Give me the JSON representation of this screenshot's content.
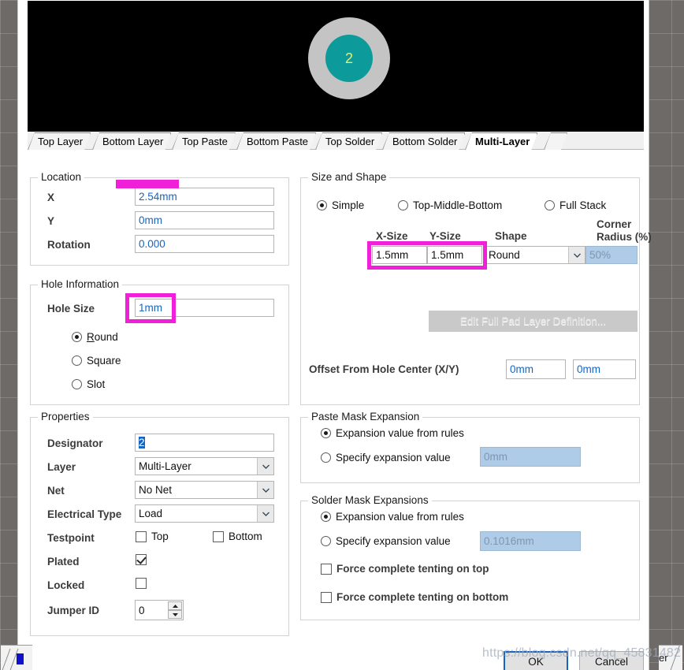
{
  "preview": {
    "pad_designator": "2",
    "colors": {
      "background": "#000000",
      "pad_outer": "#c3c4c3",
      "pad_inner": "#0c9a9a",
      "label": "#e8ef6b"
    }
  },
  "layer_tabs": [
    {
      "label": "Top Layer",
      "active": false
    },
    {
      "label": "Bottom Layer",
      "active": false
    },
    {
      "label": "Top Paste",
      "active": false
    },
    {
      "label": "Bottom Paste",
      "active": false
    },
    {
      "label": "Top Solder",
      "active": false
    },
    {
      "label": "Bottom Solder",
      "active": false
    },
    {
      "label": "Multi-Layer",
      "active": true
    }
  ],
  "location": {
    "legend": "Location",
    "x_label": "X",
    "x_value": "2.54mm",
    "y_label": "Y",
    "y_value": "0mm",
    "rotation_label": "Rotation",
    "rotation_value": "0.000"
  },
  "hole_information": {
    "legend": "Hole Information",
    "hole_size_label": "Hole Size",
    "hole_size_value": "1mm",
    "shapes": [
      {
        "label": "Round",
        "selected": true
      },
      {
        "label": "Square",
        "selected": false
      },
      {
        "label": "Slot",
        "selected": false
      }
    ]
  },
  "properties": {
    "legend": "Properties",
    "designator_label": "Designator",
    "designator_value": "2",
    "layer_label": "Layer",
    "layer_value": "Multi-Layer",
    "net_label": "Net",
    "net_value": "No Net",
    "electrical_type_label": "Electrical Type",
    "electrical_type_value": "Load",
    "testpoint_label": "Testpoint",
    "testpoint_top_label": "Top",
    "testpoint_top_checked": false,
    "testpoint_bottom_label": "Bottom",
    "testpoint_bottom_checked": false,
    "plated_label": "Plated",
    "plated_checked": true,
    "locked_label": "Locked",
    "locked_checked": false,
    "jumper_id_label": "Jumper ID",
    "jumper_id_value": "0"
  },
  "size_and_shape": {
    "legend": "Size and Shape",
    "modes": [
      {
        "label": "Simple",
        "selected": true
      },
      {
        "label": "Top-Middle-Bottom",
        "selected": false
      },
      {
        "label": "Full Stack",
        "selected": false
      }
    ],
    "x_size_header": "X-Size",
    "y_size_header": "Y-Size",
    "shape_header": "Shape",
    "corner_radius_header_line1": "Corner",
    "corner_radius_header_line2": "Radius (%)",
    "x_size_value": "1.5mm",
    "y_size_value": "1.5mm",
    "shape_value": "Round",
    "corner_radius_value": "50%",
    "corner_radius_disabled": true,
    "edit_full_pad_button": "Edit Full Pad Layer Definition...",
    "edit_full_pad_disabled": true,
    "offset_label": "Offset From Hole Center (X/Y)",
    "offset_x_value": "0mm",
    "offset_y_value": "0mm"
  },
  "paste_mask_expansion": {
    "legend": "Paste Mask Expansion",
    "from_rules_label": "Expansion value from rules",
    "from_rules_selected": true,
    "specify_label": "Specify expansion value",
    "specify_selected": false,
    "specify_value": "0mm",
    "specify_disabled": true
  },
  "solder_mask_expansions": {
    "legend": "Solder Mask Expansions",
    "from_rules_label": "Expansion value from rules",
    "from_rules_selected": true,
    "specify_label": "Specify expansion value",
    "specify_selected": false,
    "specify_value": "0.1016mm",
    "specify_disabled": true,
    "tent_top_label": "Force complete tenting on top",
    "tent_top_checked": false,
    "tent_bottom_label": "Force complete tenting on bottom",
    "tent_bottom_checked": false
  },
  "footer": {
    "ok_label": "OK",
    "cancel_label": "Cancel"
  },
  "annotations": {
    "highlight_color": "#f020d8",
    "targets": [
      "location-x-field",
      "hole-size-field",
      "pad-x-size-y-size-fields"
    ]
  },
  "watermark": {
    "text": "https://blog.csdn.net/qq_45831482"
  },
  "stray_tab_right_label": "er"
}
